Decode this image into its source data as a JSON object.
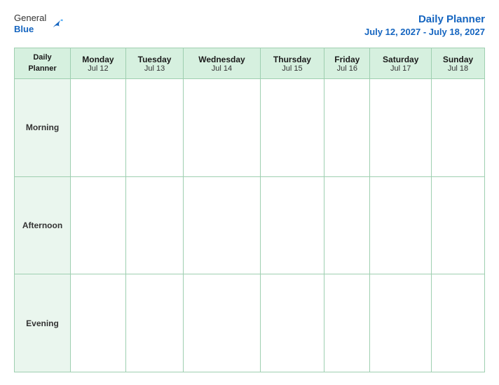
{
  "logo": {
    "general": "General",
    "blue": "Blue"
  },
  "title": {
    "main": "Daily Planner",
    "sub": "July 12, 2027 - July 18, 2027"
  },
  "table": {
    "header_first": "Daily\nPlanner",
    "columns": [
      {
        "day": "Monday",
        "date": "Jul 12"
      },
      {
        "day": "Tuesday",
        "date": "Jul 13"
      },
      {
        "day": "Wednesday",
        "date": "Jul 14"
      },
      {
        "day": "Thursday",
        "date": "Jul 15"
      },
      {
        "day": "Friday",
        "date": "Jul 16"
      },
      {
        "day": "Saturday",
        "date": "Jul 17"
      },
      {
        "day": "Sunday",
        "date": "Jul 18"
      }
    ],
    "rows": [
      {
        "label": "Morning"
      },
      {
        "label": "Afternoon"
      },
      {
        "label": "Evening"
      }
    ]
  }
}
